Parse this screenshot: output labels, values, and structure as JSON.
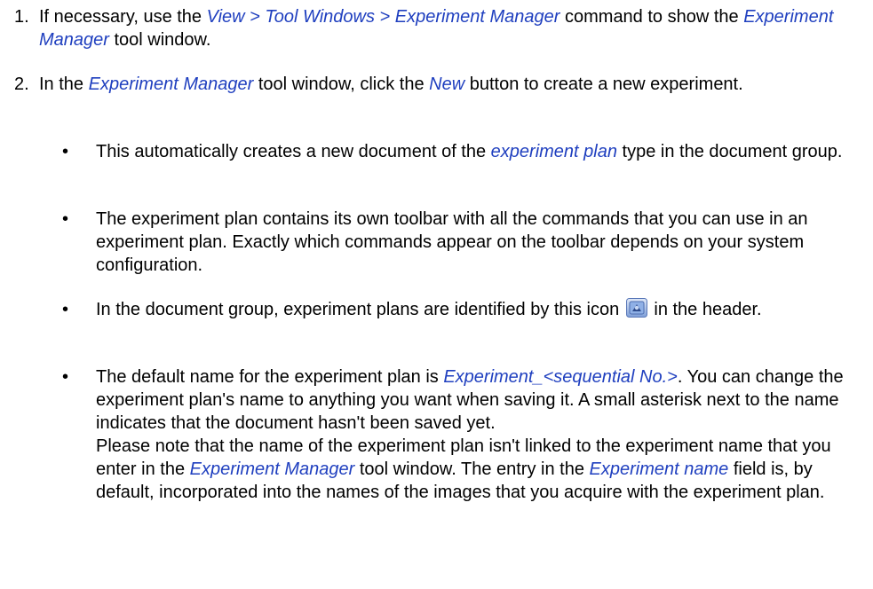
{
  "colors": {
    "text": "#000000",
    "link": "#1f3fbf",
    "icon_blue": "#6c8fd0"
  },
  "steps": [
    {
      "number": "1.",
      "t1": "If necessary, use the ",
      "link1": "View > Tool Windows > Experiment Manager",
      "t2": " command to show the ",
      "link2": "Experiment Manager",
      "t3": " tool window."
    },
    {
      "number": "2.",
      "t1": "In the ",
      "link1": "Experiment Manager",
      "t2": " tool window, click the ",
      "link2": "New",
      "t3": " button to create a new experiment."
    }
  ],
  "bullets": [
    {
      "t1": "This automatically creates a new document of the ",
      "link1": "experiment plan",
      "t2": " type in the document group."
    },
    {
      "t1": "The experiment plan contains its own toolbar with all the commands that you can use in an experiment plan. Exactly which commands appear on the toolbar depends on your system configuration."
    },
    {
      "t1": "In the document group, experiment plans are identified by this icon",
      "icon": "experiment-plan-icon",
      "t2": " in the header."
    },
    {
      "t1": "The default name for the experiment plan is ",
      "link1": "Experiment_<sequential No.>",
      "t2": ". You can change the experiment plan's name to anything you want when saving it. A small asterisk next to the name indicates that the document hasn't been saved yet.",
      "t3": "Please note that the name of the experiment plan isn't linked to the experiment name that you enter in the ",
      "link2": "Experiment Manager",
      "t4": " tool window. The entry in the ",
      "link3": "Experiment name",
      "t5": " field is, by default, incorporated into the names of the images that you acquire with the experiment plan."
    }
  ],
  "bullet_symbol": "•"
}
